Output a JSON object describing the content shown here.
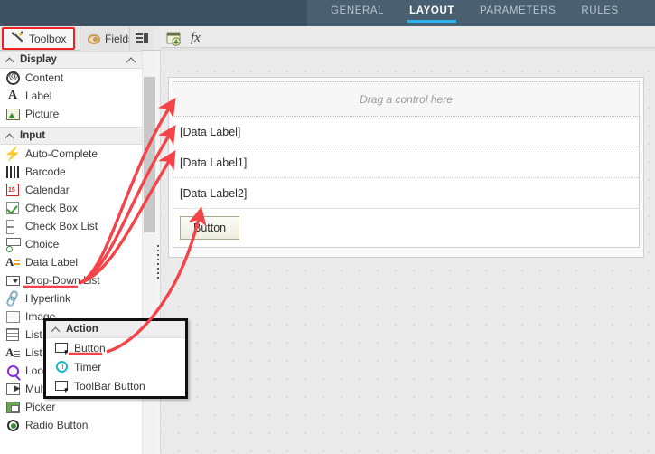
{
  "topnav": {
    "items": [
      {
        "label": "GENERAL",
        "active": false
      },
      {
        "label": "LAYOUT",
        "active": true
      },
      {
        "label": "PARAMETERS",
        "active": false
      },
      {
        "label": "RULES",
        "active": false
      }
    ],
    "accent_color": "#29b3f0",
    "bar_color": "#4a6070"
  },
  "tabs": {
    "toolbox": "Toolbox",
    "fields": "Fields",
    "toolbox_icon": "wrench-screwdriver-icon",
    "fields_icon": "fields-circle-icon",
    "more_icon": "list-view-icon",
    "highlight_color": "#ee2222"
  },
  "toolbar": {
    "image_icon": "insert-image-icon",
    "fx_label": "fx"
  },
  "toolbox": {
    "groups": [
      {
        "title": "Display",
        "items": [
          {
            "label": "Content",
            "icon": "at-sign-icon"
          },
          {
            "label": "Label",
            "icon": "letter-a-icon"
          },
          {
            "label": "Picture",
            "icon": "picture-icon"
          }
        ]
      },
      {
        "title": "Input",
        "items": [
          {
            "label": "Auto-Complete",
            "icon": "lightning-bolt-icon"
          },
          {
            "label": "Barcode",
            "icon": "barcode-icon"
          },
          {
            "label": "Calendar",
            "icon": "calendar-icon"
          },
          {
            "label": "Check Box",
            "icon": "check-box-icon"
          },
          {
            "label": "Check Box List",
            "icon": "check-box-list-icon"
          },
          {
            "label": "Choice",
            "icon": "choice-icon"
          },
          {
            "label": "Data Label",
            "icon": "data-label-icon"
          },
          {
            "label": "Drop-Down List",
            "icon": "drop-down-list-icon"
          },
          {
            "label": "Hyperlink",
            "icon": "link-icon"
          },
          {
            "label": "Image",
            "icon": "image-icon"
          },
          {
            "label": "List Box",
            "icon": "list-box-icon"
          },
          {
            "label": "List Data",
            "icon": "list-data-icon"
          },
          {
            "label": "Lookup",
            "icon": "magnifier-icon"
          },
          {
            "label": "Multi-Select",
            "icon": "multi-select-icon"
          },
          {
            "label": "Picker",
            "icon": "picker-icon"
          },
          {
            "label": "Radio Button",
            "icon": "radio-button-icon"
          }
        ]
      }
    ]
  },
  "flyout": {
    "title": "Action",
    "items": [
      {
        "label": "Button",
        "icon": "button-cursor-icon"
      },
      {
        "label": "Timer",
        "icon": "timer-clock-icon"
      },
      {
        "label": "ToolBar Button",
        "icon": "toolbar-button-icon"
      }
    ]
  },
  "canvas": {
    "dropzone_text": "Drag a control here",
    "rows": [
      {
        "label": "[Data Label]"
      },
      {
        "label": "[Data Label1]"
      },
      {
        "label": "[Data Label2]"
      }
    ],
    "button_label": "Button"
  },
  "annotations": {
    "arrow_color": "#f4444a",
    "count": 4
  }
}
